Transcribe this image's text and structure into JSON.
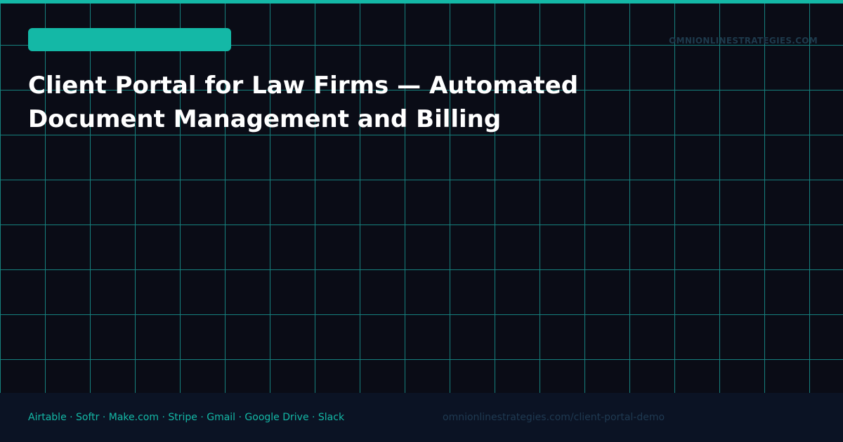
{
  "header": {
    "domain": "OMNIONLINESTRATEGIES.COM"
  },
  "title": {
    "line1": "Client Portal for Law Firms — Automated",
    "line2": "Document Management and Billing"
  },
  "footer": {
    "stack": "Airtable · Softr · Make.com · Stripe · Gmail · Google Drive · Slack",
    "link": "omnionlinestrategies.com/client-portal-demo"
  },
  "colors": {
    "background": "#0a0d16",
    "accent": "#14b8a6",
    "grid": "#1aa8a0",
    "footer_bg": "#0b1324",
    "muted_text": "#1f3a52",
    "title_text": "#ffffff"
  }
}
